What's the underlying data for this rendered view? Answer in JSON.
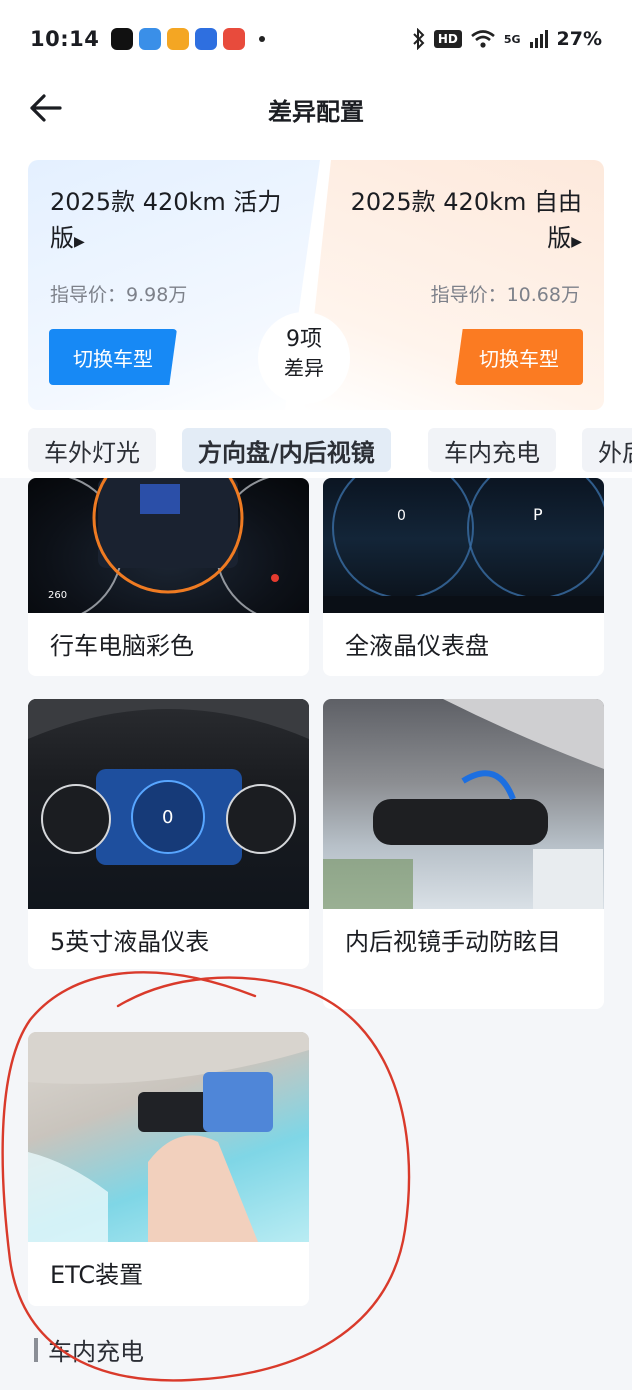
{
  "status_bar": {
    "time": "10:14",
    "network": "5G",
    "battery": "27%",
    "hd_label": "HD",
    "app_icon_colors": [
      "#111111",
      "#3a8fe8",
      "#f4a623",
      "#2e6fe0",
      "#e84b3c"
    ],
    "icons": [
      "bluetooth-icon",
      "wifi-icon",
      "signal-icon"
    ]
  },
  "header": {
    "title": "差异配置",
    "back_icon": "arrow-left-icon"
  },
  "compare": {
    "left": {
      "model": "2025款 420km 活力版",
      "price": "指导价：9.98万",
      "switch_label": "切换车型",
      "accent": "#1789f5"
    },
    "right": {
      "model": "2025款 420km 自由版",
      "price": "指导价：10.68万",
      "switch_label": "切换车型",
      "accent": "#fb7b22"
    },
    "diff_count": "9项",
    "diff_label": "差异"
  },
  "tabs": [
    {
      "label": "车外灯光",
      "active": false
    },
    {
      "label": "方向盘/内后视镜",
      "active": true
    },
    {
      "label": "车内充电",
      "active": false
    },
    {
      "label": "外后",
      "active": false
    }
  ],
  "features": [
    {
      "label": "行车电脑彩色",
      "image": "instrument-cluster-image"
    },
    {
      "label": "全液晶仪表盘",
      "image": "lcd-dashboard-image"
    },
    {
      "label": "5英寸液晶仪表",
      "image": "small-lcd-cluster-image"
    },
    {
      "label": "内后视镜手动防眩目",
      "image": "rearview-mirror-image"
    },
    {
      "label": "ETC装置",
      "image": "etc-device-image"
    }
  ],
  "next_section": {
    "title": "车内充电"
  },
  "annotation_color": "#d93a2b"
}
